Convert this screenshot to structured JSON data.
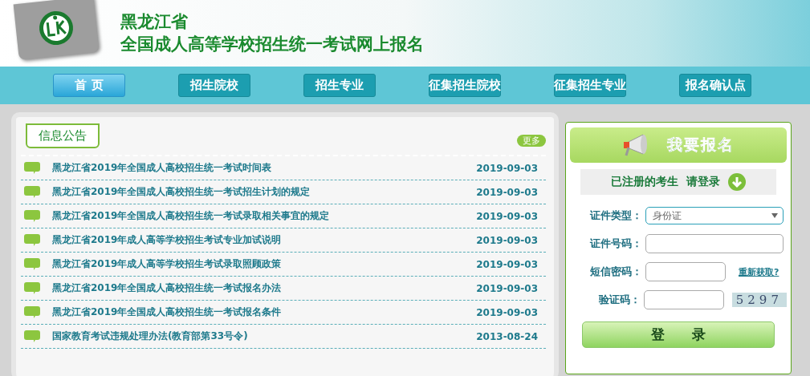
{
  "header": {
    "province": "黑龙江省",
    "title": "全国成人高等学校招生统一考试网上报名"
  },
  "nav": [
    {
      "label": "首 页",
      "selected": true
    },
    {
      "label": "招生院校",
      "selected": false
    },
    {
      "label": "招生专业",
      "selected": false
    },
    {
      "label": "征集招生院校",
      "selected": false
    },
    {
      "label": "征集招生专业",
      "selected": false
    },
    {
      "label": "报名确认点",
      "selected": false
    }
  ],
  "notices": {
    "title": "信息公告",
    "more": "更多",
    "items": [
      {
        "title": "黑龙江省2019年全国成人高校招生统一考试时间表",
        "date": "2019-09-03"
      },
      {
        "title": "黑龙江省2019年全国成人高校招生统一考试招生计划的规定",
        "date": "2019-09-03"
      },
      {
        "title": "黑龙江省2019年全国成人高校招生统一考试录取相关事宜的规定",
        "date": "2019-09-03"
      },
      {
        "title": "黑龙江省2019年成人高等学校招生考试专业加试说明",
        "date": "2019-09-03"
      },
      {
        "title": "黑龙江省2019年成人高等学校招生考试录取照顾政策",
        "date": "2019-09-03"
      },
      {
        "title": "黑龙江省2019年全国成人高校招生统一考试报名办法",
        "date": "2019-09-03"
      },
      {
        "title": "黑龙江省2019年全国成人高校招生统一考试报名条件",
        "date": "2019-09-03"
      },
      {
        "title": "国家教育考试违规处理办法(教育部第33号令)",
        "date": "2013-08-24"
      }
    ]
  },
  "register": {
    "banner": "我要报名",
    "login_hint": "已注册的考生  请登录",
    "fields": [
      {
        "kind": "select",
        "label": "证件类型：",
        "value": "身份证"
      },
      {
        "kind": "input",
        "label": "证件号码："
      },
      {
        "kind": "sms",
        "label": "短信密码：",
        "link": "重新获取?"
      },
      {
        "kind": "captcha",
        "label": "验证码：",
        "captcha": "5297"
      }
    ],
    "submit": "登　　录"
  }
}
